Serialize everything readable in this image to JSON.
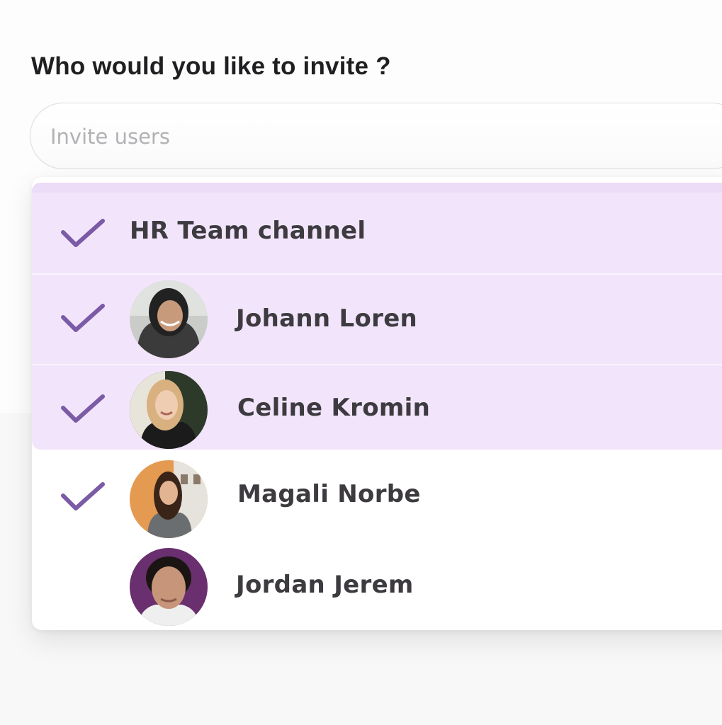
{
  "heading": "Who would you like to invite ?",
  "search": {
    "placeholder": "Invite users",
    "value": ""
  },
  "options": [
    {
      "label": "HR Team channel",
      "selected": true,
      "icon": "check-icon"
    },
    {
      "label": "Johann Loren",
      "selected": true,
      "icon": "check-icon",
      "avatar": "avatar-photo"
    },
    {
      "label": "Celine Kromin",
      "selected": true,
      "icon": "check-icon",
      "avatar": "avatar-photo"
    },
    {
      "label": "Magali Norbe",
      "selected": true,
      "icon": "check-icon",
      "avatar": "avatar-photo"
    },
    {
      "label": "Jordan Jerem",
      "selected": false,
      "avatar": "avatar-photo"
    }
  ],
  "colors": {
    "selected_bg": "#f2e5fb",
    "check": "#7b5aa6",
    "text": "#3d3b40",
    "heading": "#1f1f21",
    "placeholder": "#b2b2b6"
  }
}
